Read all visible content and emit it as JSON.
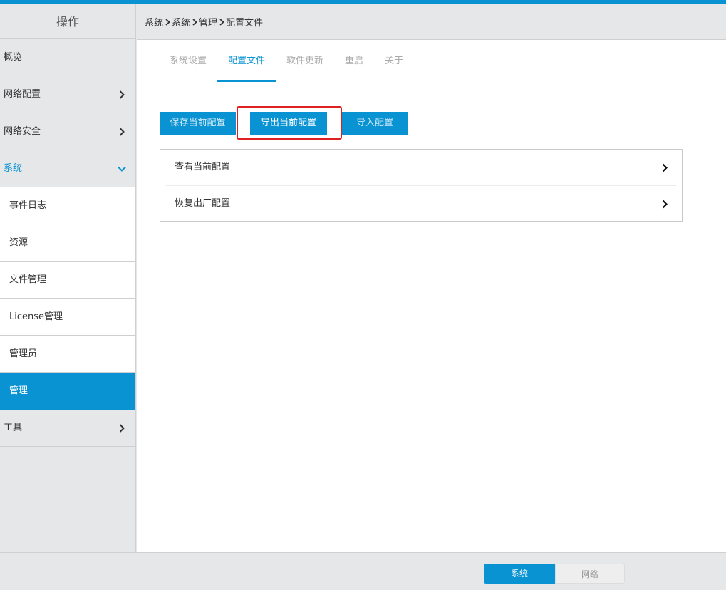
{
  "colors": {
    "accent": "#0a93d3",
    "highlight": "#e0201e",
    "sidebar_bg": "#e6e7e8"
  },
  "sidebar": {
    "header": "操作",
    "items": [
      {
        "label": "概览"
      },
      {
        "label": "网络配置",
        "icon": "chevron-right-icon"
      },
      {
        "label": "网络安全",
        "icon": "chevron-right-icon"
      },
      {
        "label": "系统",
        "icon": "chevron-down-icon"
      }
    ],
    "sub_items": [
      {
        "label": "事件日志"
      },
      {
        "label": "资源"
      },
      {
        "label": "文件管理"
      },
      {
        "label": "License管理"
      },
      {
        "label": "管理员"
      },
      {
        "label": "管理"
      }
    ],
    "tools": {
      "label": "工具",
      "icon": "chevron-right-icon"
    }
  },
  "breadcrumb": [
    "系统",
    "系统",
    "管理",
    "配置文件"
  ],
  "tabs": [
    {
      "label": "系统设置"
    },
    {
      "label": "配置文件"
    },
    {
      "label": "软件更新"
    },
    {
      "label": "重启"
    },
    {
      "label": "关于"
    }
  ],
  "active_tab": "配置文件",
  "actions": {
    "save": "保存当前配置",
    "export": "导出当前配置",
    "import": "导入配置"
  },
  "config_list": [
    {
      "label": "查看当前配置"
    },
    {
      "label": "恢复出厂配置"
    }
  ],
  "footer": {
    "system": "系统",
    "network": "网络",
    "selected": "系统"
  }
}
